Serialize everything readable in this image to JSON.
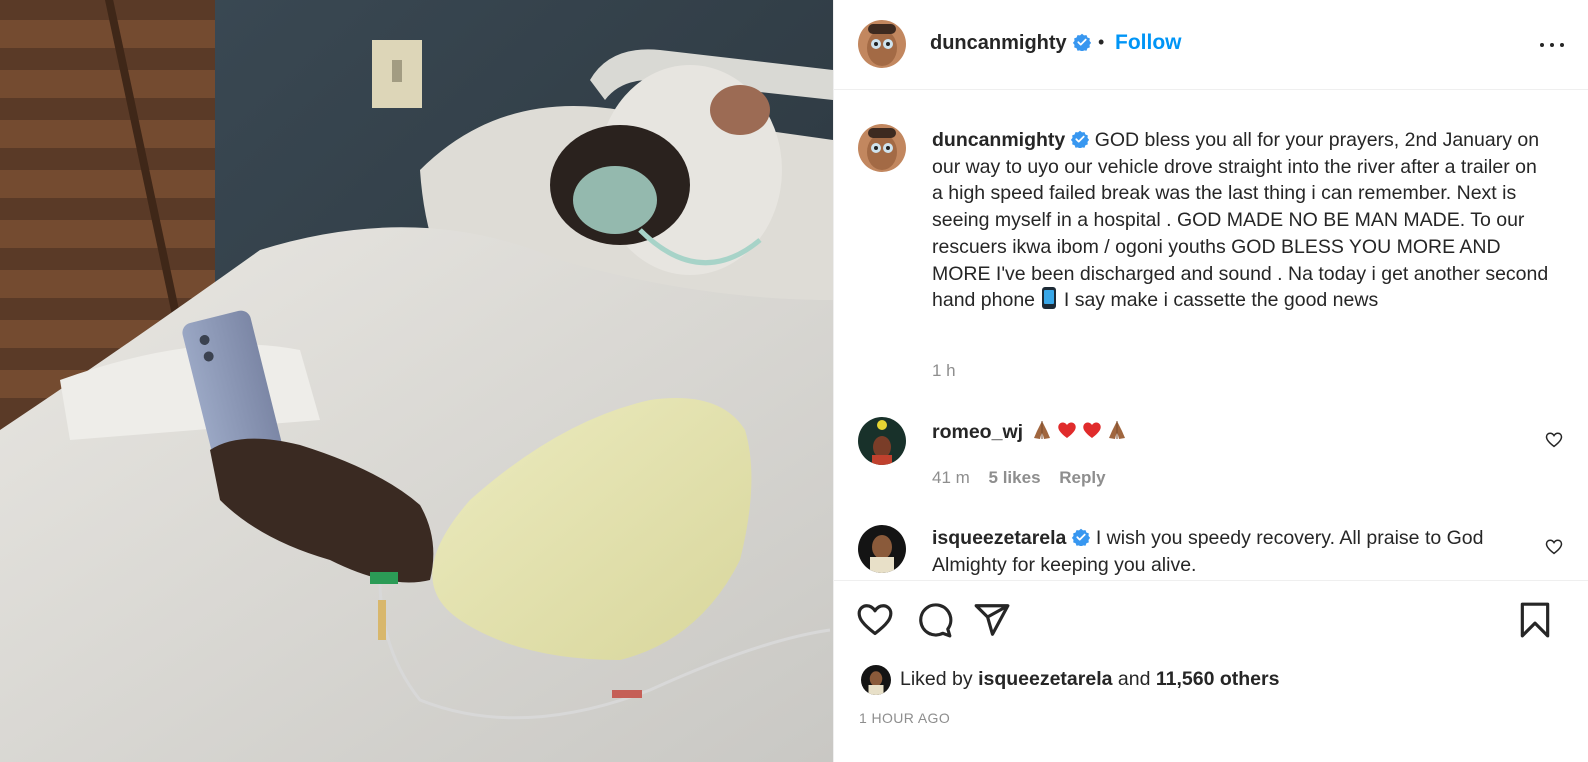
{
  "post": {
    "author": "duncanmighty",
    "follow_label": "Follow",
    "separator": "•",
    "caption": "GOD bless you all for your prayers, 2nd January on our way to uyo our vehicle drove straight into the river after a trailer on a high speed failed break was the last thing i can remember. Next is seeing myself in a hospital . GOD MADE NO BE MAN MADE. To our rescuers ikwa ibom / ogoni youths GOD BLESS YOU MORE AND MORE I've been discharged and sound . Na today i get another second hand phone",
    "caption_end": "I say make i cassette the good news",
    "caption_time": "1 h",
    "liked_by_user": "isqueezetarela",
    "liked_by_and": "and",
    "liked_by_prefix": "Liked by",
    "likes_others": "11,560 others",
    "date": "1 HOUR AGO"
  },
  "comments": [
    {
      "username": "romeo_wj",
      "text": "",
      "time": "41 m",
      "likes": "5 likes",
      "reply": "Reply"
    },
    {
      "username": "isqueezetarela",
      "text": "I wish you speedy recovery. All praise to God Almighty for keeping you alive."
    }
  ],
  "colors": {
    "accent": "#0095f6",
    "verified": "#3897f0",
    "muted": "#8e8e8e",
    "text": "#262626"
  },
  "icons": {
    "more": "more-horizontal-icon",
    "like": "heart-icon",
    "comment": "comment-icon",
    "share": "paper-plane-icon",
    "save": "bookmark-icon",
    "verified": "verified-badge-icon"
  }
}
